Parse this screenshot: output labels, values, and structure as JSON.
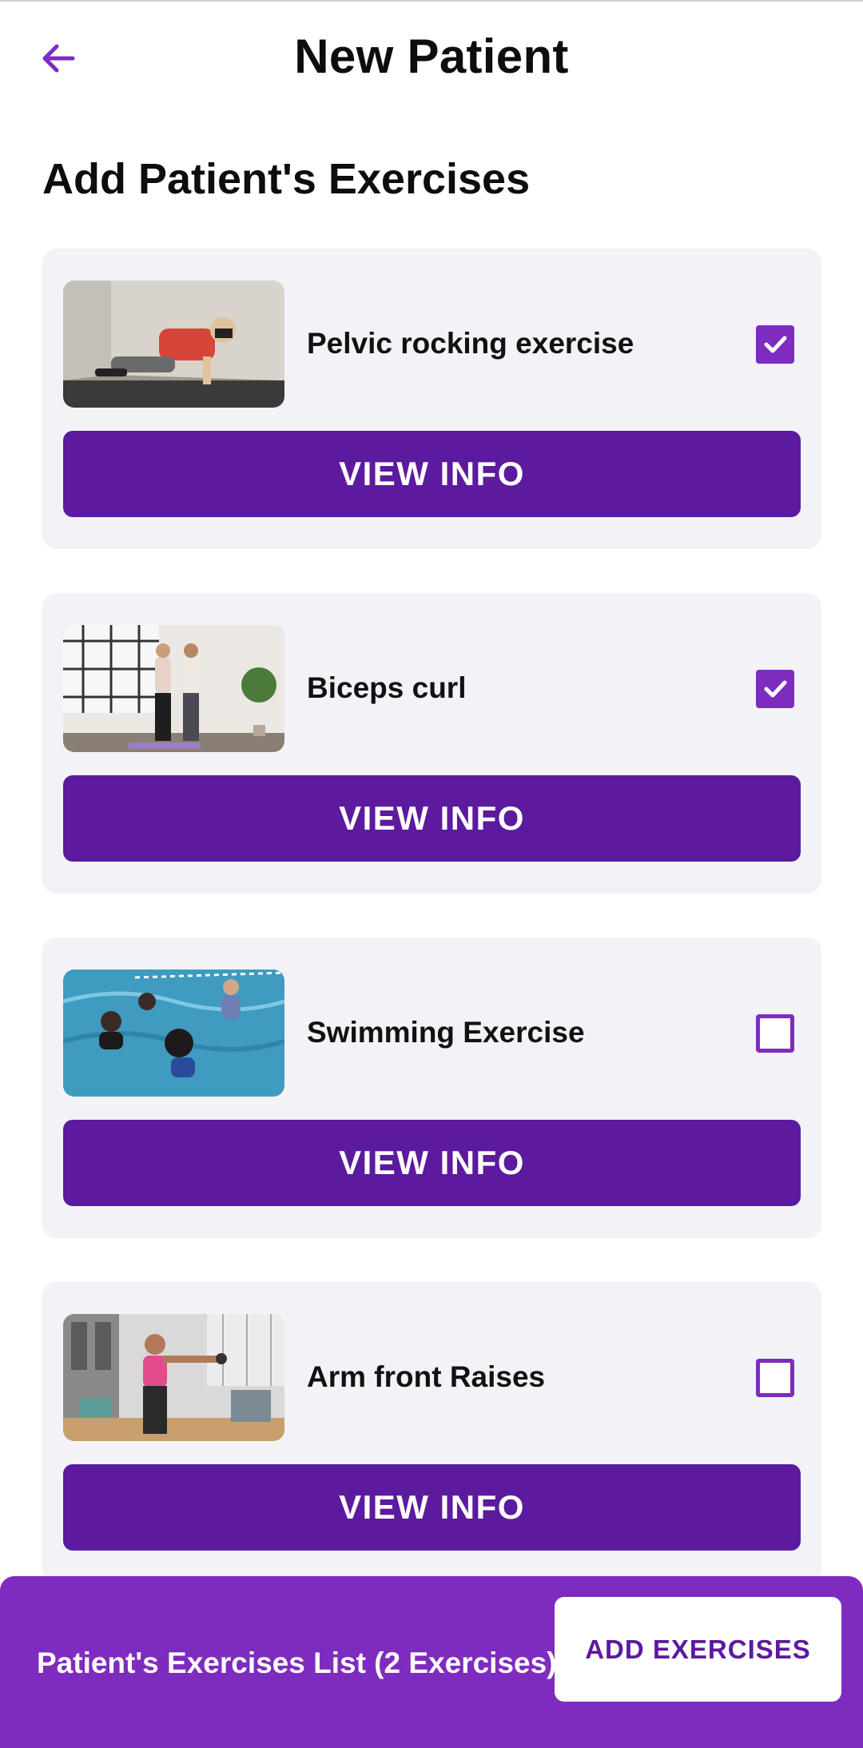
{
  "header": {
    "title": "New Patient",
    "back_icon": "arrow-left-icon",
    "accent_color": "#7e2bbf"
  },
  "section_title": "Add Patient's Exercises",
  "exercises": [
    {
      "name": "Pelvic rocking exercise",
      "checked": true,
      "button_label": "VIEW INFO"
    },
    {
      "name": "Biceps curl",
      "checked": true,
      "button_label": "VIEW INFO"
    },
    {
      "name": "Swimming Exercise",
      "checked": false,
      "button_label": "VIEW INFO"
    },
    {
      "name": "Arm front Raises",
      "checked": false,
      "button_label": "VIEW INFO"
    }
  ],
  "bottom_bar": {
    "summary": "Patient's Exercises List (2 Exercises)",
    "add_button_label": "ADD EXERCISES"
  },
  "colors": {
    "primary": "#7e2bbf",
    "button": "#5c1a9e",
    "card_bg": "#f2f2f7"
  }
}
